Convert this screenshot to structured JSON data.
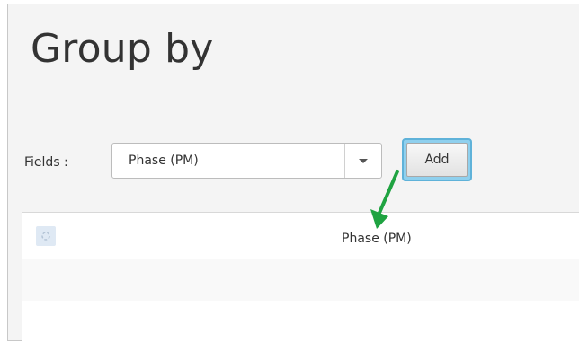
{
  "title": "Group by",
  "fields": {
    "label": "Fields :",
    "selected": "Phase (PM)"
  },
  "add_label": "Add",
  "table": {
    "rows": [
      {
        "name": "Phase (PM)"
      },
      {
        "name": ""
      },
      {
        "name": ""
      }
    ]
  },
  "icons": [
    "chevron-down-icon",
    "drag-handle-icon",
    "annotation-arrow-icon"
  ],
  "colors": {
    "add_focus": "#8fd0ee",
    "annotation_arrow": "#1fa341"
  }
}
